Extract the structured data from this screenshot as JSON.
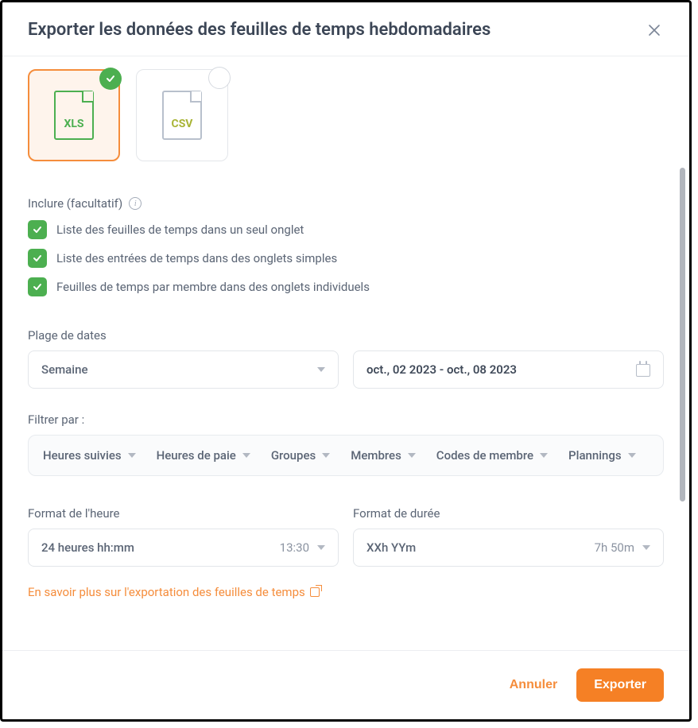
{
  "header": {
    "title": "Exporter les données des feuilles de temps hebdomadaires"
  },
  "formats": {
    "xls_label": "XLS",
    "csv_label": "CSV"
  },
  "include": {
    "section_label": "Inclure (facultatif)",
    "opt1": "Liste des feuilles de temps dans un seul onglet",
    "opt2": "Liste des entrées de temps dans des onglets simples",
    "opt3": "Feuilles de temps par membre dans des onglets individuels"
  },
  "date_range": {
    "label": "Plage de dates",
    "period_value": "Semaine",
    "range_value": "oct., 02 2023 - oct., 08 2023"
  },
  "filter": {
    "label": "Filtrer par :",
    "f1": "Heures suivies",
    "f2": "Heures de paie",
    "f3": "Groupes",
    "f4": "Membres",
    "f5": "Codes de membre",
    "f6": "Plannings"
  },
  "time_format": {
    "label": "Format de l'heure",
    "value": "24 heures hh:mm",
    "hint": "13:30"
  },
  "duration_format": {
    "label": "Format de durée",
    "value": "XXh YYm",
    "hint": "7h 50m"
  },
  "link": {
    "text": "En savoir plus sur l'exportation des feuilles de temps"
  },
  "footer": {
    "cancel": "Annuler",
    "export": "Exporter"
  }
}
